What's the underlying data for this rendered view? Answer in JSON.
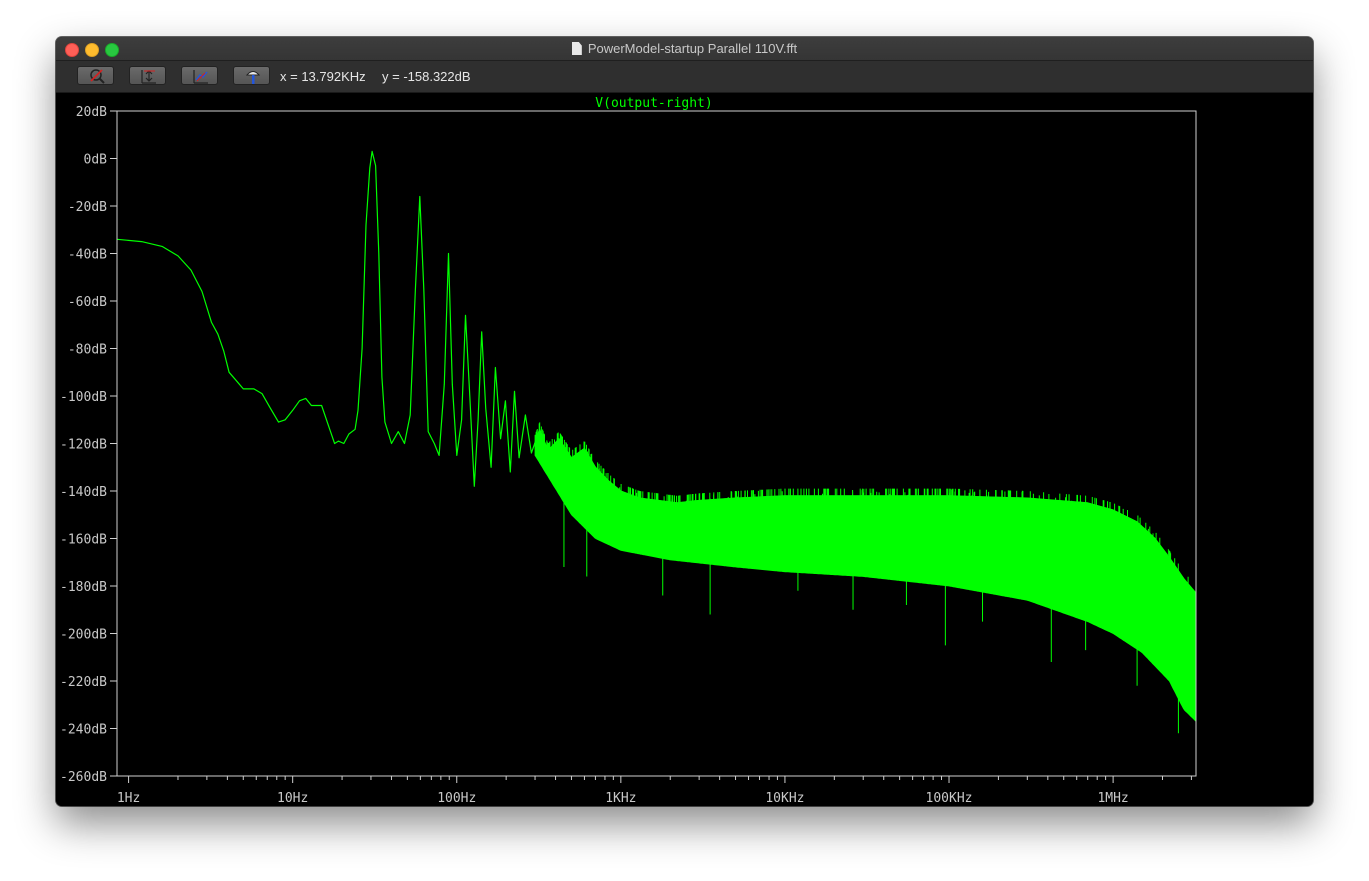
{
  "window": {
    "title": "PowerModel-startup Parallel 110V.fft"
  },
  "toolbar": {
    "buttons": [
      {
        "icon": "zoom-cancel-icon"
      },
      {
        "icon": "autorange-y-icon"
      },
      {
        "icon": "autorange-xy-icon"
      },
      {
        "icon": "pan-icon"
      }
    ],
    "x_readout": "x = 13.792KHz",
    "y_readout": "y = -158.322dB"
  },
  "colors": {
    "trace": "#00ff00",
    "axis": "#d0d0d0",
    "label": "#c8c8c8",
    "background": "#000000"
  },
  "chart_data": {
    "type": "line",
    "title": "V(output-right)",
    "x_scale": "log",
    "xlim": [
      0.85,
      3200000
    ],
    "ylim": [
      -260,
      20
    ],
    "x_ticks": [
      {
        "value": 1,
        "label": "1Hz"
      },
      {
        "value": 10,
        "label": "10Hz"
      },
      {
        "value": 100,
        "label": "100Hz"
      },
      {
        "value": 1000,
        "label": "1KHz"
      },
      {
        "value": 10000,
        "label": "10KHz"
      },
      {
        "value": 100000,
        "label": "100KHz"
      },
      {
        "value": 1000000,
        "label": "1MHz"
      }
    ],
    "y_ticks": [
      {
        "value": 20,
        "label": "20dB"
      },
      {
        "value": 0,
        "label": "0dB"
      },
      {
        "value": -20,
        "label": "-20dB"
      },
      {
        "value": -40,
        "label": "-40dB"
      },
      {
        "value": -60,
        "label": "-60dB"
      },
      {
        "value": -80,
        "label": "-80dB"
      },
      {
        "value": -100,
        "label": "-100dB"
      },
      {
        "value": -120,
        "label": "-120dB"
      },
      {
        "value": -140,
        "label": "-140dB"
      },
      {
        "value": -160,
        "label": "-160dB"
      },
      {
        "value": -180,
        "label": "-180dB"
      },
      {
        "value": -200,
        "label": "-200dB"
      },
      {
        "value": -220,
        "label": "-220dB"
      },
      {
        "value": -240,
        "label": "-240dB"
      },
      {
        "value": -260,
        "label": "-260dB"
      }
    ],
    "grid": false,
    "series": [
      {
        "points": [
          [
            0.85,
            -34
          ],
          [
            1.2,
            -35
          ],
          [
            1.6,
            -37
          ],
          [
            2.0,
            -41
          ],
          [
            2.4,
            -47
          ],
          [
            2.8,
            -56
          ],
          [
            3.2,
            -69
          ],
          [
            3.5,
            -74
          ],
          [
            3.8,
            -81
          ],
          [
            4.1,
            -90
          ],
          [
            4.6,
            -94
          ],
          [
            5.0,
            -97
          ],
          [
            5.8,
            -97
          ],
          [
            6.5,
            -99
          ],
          [
            7.3,
            -105
          ],
          [
            8.2,
            -111
          ],
          [
            9.0,
            -110
          ],
          [
            10.0,
            -106
          ],
          [
            11.0,
            -102
          ],
          [
            12.0,
            -101
          ],
          [
            13.0,
            -104
          ],
          [
            15.0,
            -104
          ],
          [
            17.0,
            -115
          ],
          [
            18.0,
            -120
          ],
          [
            19.0,
            -119
          ],
          [
            20.5,
            -120
          ],
          [
            22.0,
            -116
          ],
          [
            24.0,
            -114
          ],
          [
            25.0,
            -106
          ],
          [
            26.5,
            -80
          ],
          [
            28.0,
            -28
          ],
          [
            29.5,
            -4
          ],
          [
            30.5,
            3
          ],
          [
            32.0,
            -3
          ],
          [
            33.5,
            -40
          ],
          [
            35.0,
            -92
          ],
          [
            36.5,
            -111
          ],
          [
            40.0,
            -120
          ],
          [
            44.0,
            -115
          ],
          [
            48.0,
            -120
          ],
          [
            52.0,
            -108
          ],
          [
            56.0,
            -55
          ],
          [
            59.5,
            -16
          ],
          [
            63.0,
            -55
          ],
          [
            67.0,
            -115
          ],
          [
            73.0,
            -120
          ],
          [
            78.0,
            -125
          ],
          [
            84.0,
            -95
          ],
          [
            89.0,
            -40
          ],
          [
            94.0,
            -95
          ],
          [
            100.0,
            -125
          ],
          [
            107.0,
            -110
          ],
          [
            113.0,
            -66
          ],
          [
            120.0,
            -100
          ],
          [
            128.0,
            -138
          ],
          [
            135.0,
            -110
          ],
          [
            142.0,
            -73
          ],
          [
            150.0,
            -105
          ],
          [
            162.0,
            -130
          ],
          [
            172.0,
            -88
          ],
          [
            185.0,
            -118
          ],
          [
            198.0,
            -102
          ],
          [
            212.0,
            -132
          ],
          [
            225.0,
            -98
          ],
          [
            240.0,
            -126
          ],
          [
            262.0,
            -108
          ],
          [
            285.0,
            -124
          ],
          [
            320.0,
            -114
          ],
          [
            360.0,
            -123
          ],
          [
            420.0,
            -118
          ],
          [
            500.0,
            -126
          ],
          [
            600.0,
            -122
          ],
          [
            700.0,
            -130
          ],
          [
            850.0,
            -136
          ],
          [
            1000.0,
            -140
          ],
          [
            1300.0,
            -143
          ],
          [
            1700.0,
            -144
          ],
          [
            2200.0,
            -145
          ],
          [
            3000.0,
            -144
          ],
          [
            5000.0,
            -143
          ],
          [
            10000.0,
            -142
          ],
          [
            30000.0,
            -142
          ],
          [
            100000.0,
            -142
          ],
          [
            300000.0,
            -143
          ],
          [
            700000.0,
            -145
          ],
          [
            1000000.0,
            -148
          ],
          [
            1400000.0,
            -153
          ],
          [
            1800000.0,
            -160
          ],
          [
            2200000.0,
            -168
          ],
          [
            2700000.0,
            -177
          ],
          [
            3200000.0,
            -183
          ]
        ],
        "envelope_low": [
          [
            300.0,
            -125
          ],
          [
            500.0,
            -150
          ],
          [
            700.0,
            -160
          ],
          [
            1000.0,
            -165
          ],
          [
            2000.0,
            -169
          ],
          [
            5000.0,
            -172
          ],
          [
            10000.0,
            -174
          ],
          [
            30000.0,
            -176
          ],
          [
            100000.0,
            -180
          ],
          [
            300000.0,
            -186
          ],
          [
            700000.0,
            -195
          ],
          [
            1000000.0,
            -200
          ],
          [
            1500000.0,
            -208
          ],
          [
            2200000.0,
            -220
          ],
          [
            2700000.0,
            -232
          ],
          [
            3200000.0,
            -237
          ]
        ],
        "downward_spikes": [
          [
            450.0,
            -172
          ],
          [
            620.0,
            -176
          ],
          [
            1800.0,
            -184
          ],
          [
            3500.0,
            -192
          ],
          [
            12000.0,
            -182
          ],
          [
            26000.0,
            -190
          ],
          [
            55000.0,
            -188
          ],
          [
            95000.0,
            -205
          ],
          [
            160000.0,
            -195
          ],
          [
            420000.0,
            -212
          ],
          [
            680000.0,
            -207
          ],
          [
            1400000.0,
            -222
          ],
          [
            2500000.0,
            -242
          ]
        ]
      }
    ]
  }
}
